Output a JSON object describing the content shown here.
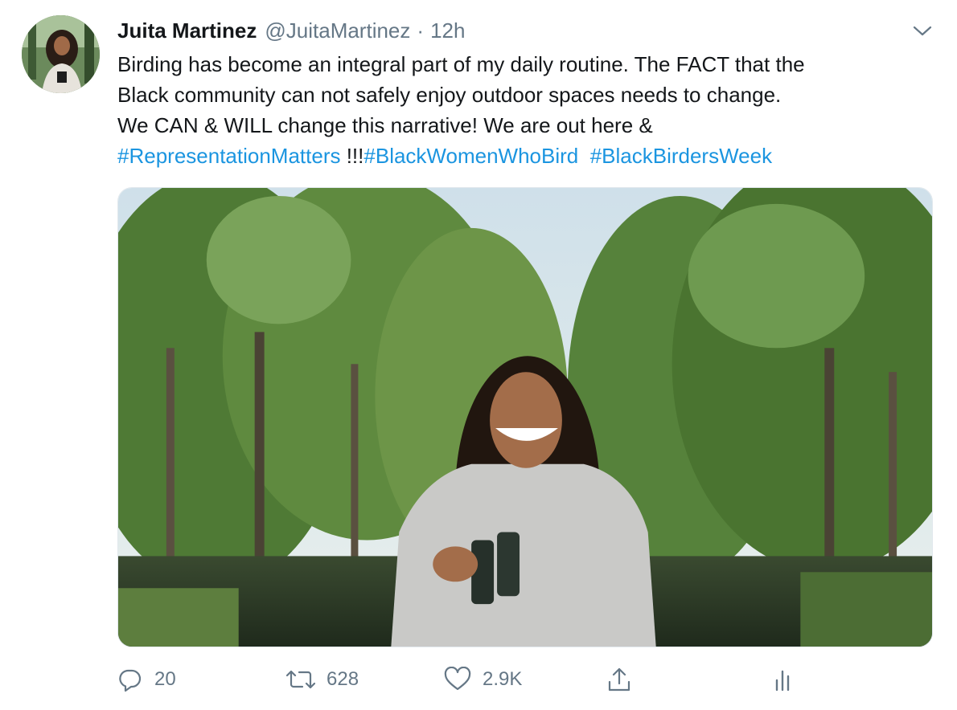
{
  "tweet": {
    "author_name": "Juita Martinez",
    "author_handle": "@JuitaMartinez",
    "separator": "·",
    "time": "12h",
    "text_lines": [
      "Birding has become an integral part of my daily routine. The FACT that the",
      "Black community can not safely enjoy outdoor spaces needs to change.",
      "We CAN & WILL change this narrative! We are out here &"
    ],
    "hashtag_line": {
      "tag1": "#RepresentationMatters",
      "mid": " !!!",
      "tag2": "#BlackWomenWhoBird",
      "tag3": "#BlackBirdersWeek"
    }
  },
  "actions": {
    "reply_count": "20",
    "retweet_count": "628",
    "like_count": "2.9K"
  },
  "colors": {
    "text": "#14171a",
    "secondary": "#657786",
    "link": "#1b95e0"
  },
  "icons": [
    "chevron-down-icon",
    "reply-icon",
    "retweet-icon",
    "like-icon",
    "share-icon",
    "analytics-icon"
  ]
}
